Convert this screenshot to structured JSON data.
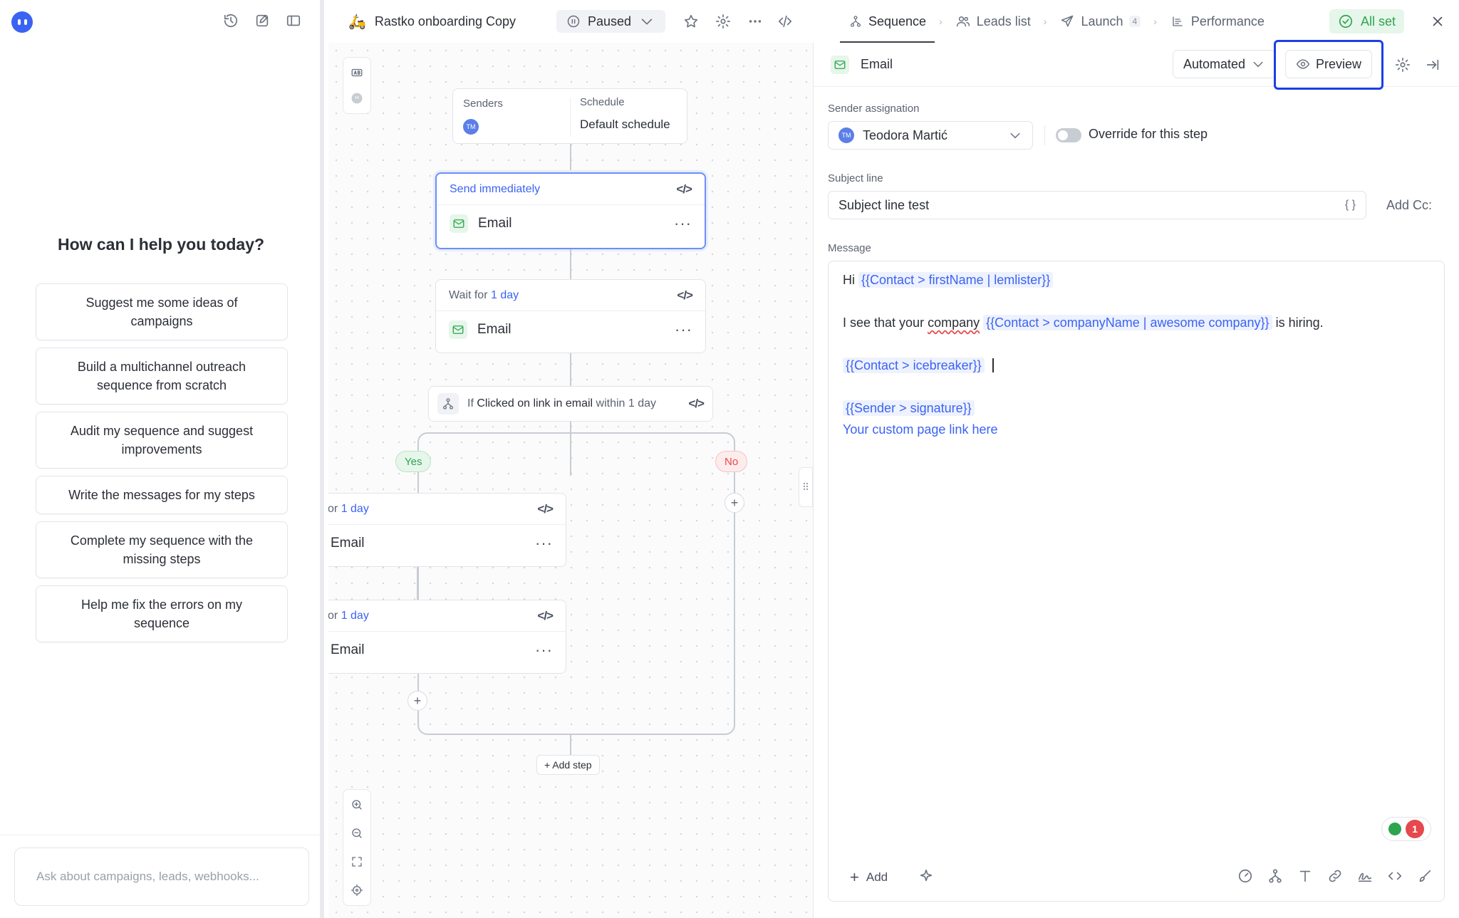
{
  "assistant": {
    "heading": "How can I help you today?",
    "suggestions": [
      "Suggest me some ideas of campaigns",
      "Build a multichannel outreach sequence from scratch",
      "Audit my sequence and suggest improvements",
      "Write the messages for my steps",
      "Complete my sequence with the missing steps",
      "Help me fix the errors on my sequence"
    ],
    "input_placeholder": "Ask about campaigns, leads, webhooks..."
  },
  "topbar": {
    "campaign_name": "Rastko onboarding Copy",
    "status": "Paused",
    "tabs": [
      {
        "label": "Sequence",
        "active": true
      },
      {
        "label": "Leads list",
        "active": false
      },
      {
        "label": "Launch",
        "badge": "4",
        "active": false
      },
      {
        "label": "Performance",
        "active": false
      }
    ],
    "all_set": "All set"
  },
  "canvas": {
    "senders_label": "Senders",
    "sender_initials": "TM",
    "schedule_label": "Schedule",
    "schedule_value": "Default schedule",
    "step1": {
      "timing": "Send immediately",
      "type": "Email"
    },
    "step2": {
      "wait_prefix": "Wait for",
      "wait_value": "1 day",
      "type": "Email"
    },
    "condition": {
      "prefix": "If",
      "event": "Clicked on link in email",
      "within": "within 1 day"
    },
    "yes_label": "Yes",
    "no_label": "No",
    "branch_step1": {
      "prefix": "or",
      "wait_value": "1 day",
      "type": "Email"
    },
    "branch_step2": {
      "prefix": "or",
      "wait_value": "1 day",
      "type": "Email"
    },
    "add_step": "+ Add step",
    "colors": {
      "accent": "#3b63f3",
      "yes": "#2ea44f",
      "no": "#e5484d"
    }
  },
  "editor": {
    "title": "Email",
    "mode": "Automated",
    "preview": "Preview",
    "sender_assignation_label": "Sender assignation",
    "sender_initials": "TM",
    "sender_name": "Teodora Martić",
    "override_label": "Override for this step",
    "subject_label": "Subject line",
    "subject_value": "Subject line test",
    "add_cc": "Add Cc:",
    "message_label": "Message",
    "message": {
      "l1_text": "Hi",
      "l1_var": "{{Contact > firstName | lemlister}}",
      "l2_pre": "I see that your",
      "l2_word": "company",
      "l2_var": "{{Contact > companyName | awesome company}}",
      "l2_post": "is hiring.",
      "l3_var": "{{Contact > icebreaker}}",
      "l4_var": "{{Sender > signature}}",
      "l5_link": "Your custom page link here"
    },
    "add_button": "Add",
    "notification_count": "1"
  }
}
